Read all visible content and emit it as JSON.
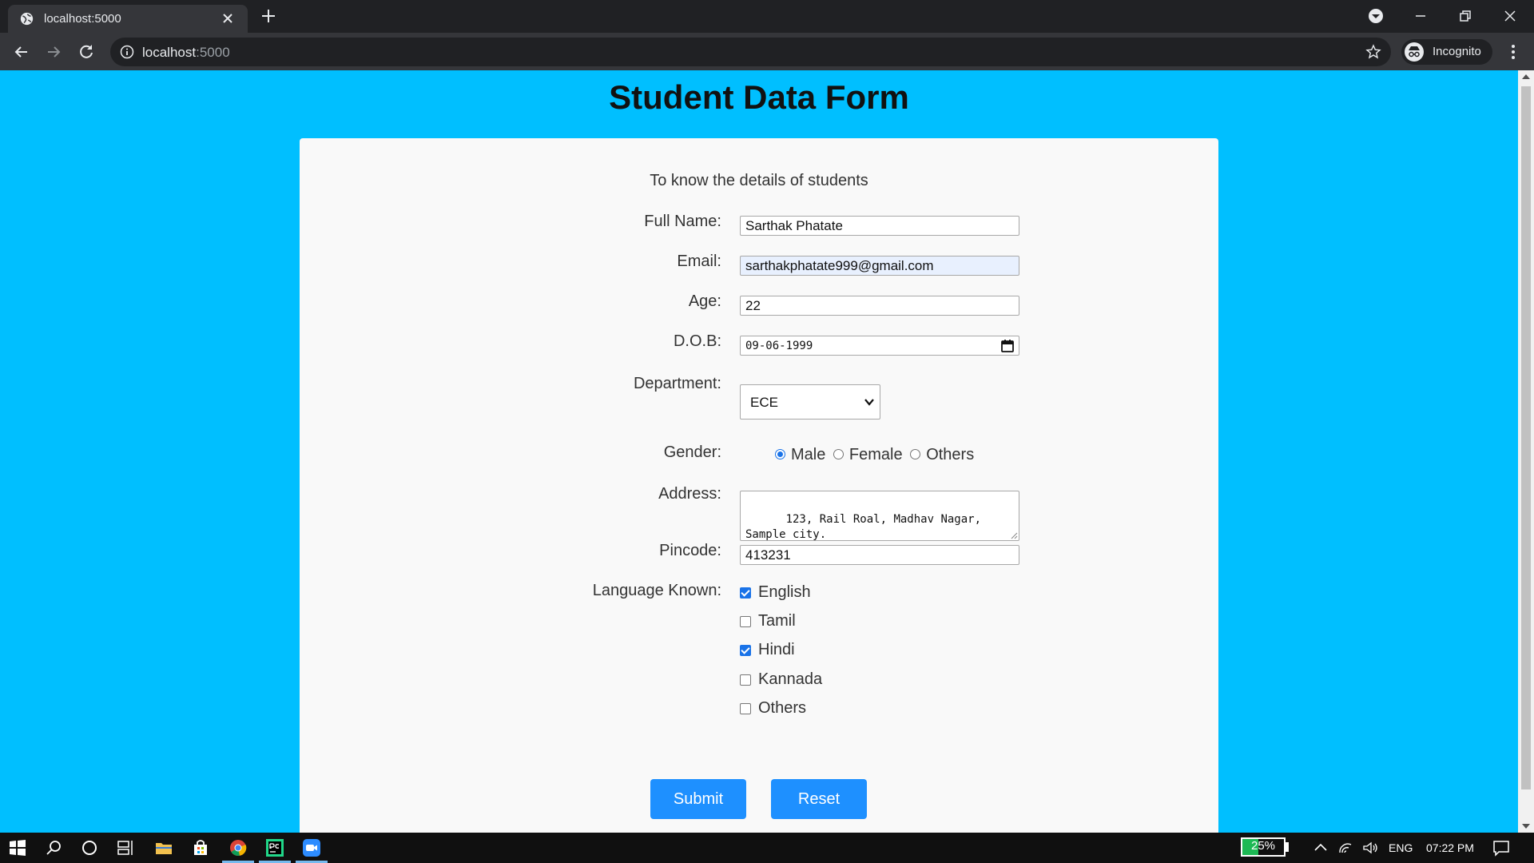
{
  "browser": {
    "tab_title": "localhost:5000",
    "url_host": "localhost",
    "url_port": ":5000",
    "profile_label": "Incognito"
  },
  "page": {
    "title": "Student Data Form",
    "subtitle": "To know the details of students"
  },
  "form": {
    "full_name": {
      "label": "Full Name:",
      "value": "Sarthak Phatate"
    },
    "email": {
      "label": "Email:",
      "value": "sarthakphatate999@gmail.com"
    },
    "age": {
      "label": "Age:",
      "value": "22"
    },
    "dob": {
      "label": "D.O.B:",
      "value": "09-06-1999"
    },
    "department": {
      "label": "Department:",
      "selected": "ECE"
    },
    "gender": {
      "label": "Gender:",
      "options": [
        "Male",
        "Female",
        "Others"
      ],
      "selected": "Male"
    },
    "address": {
      "label": "Address:",
      "value": "123, Rail Roal, Madhav Nagar, Sample city."
    },
    "pincode": {
      "label": "Pincode:",
      "value": "413231"
    },
    "languages": {
      "label": "Language Known:",
      "options": [
        {
          "label": "English",
          "checked": true
        },
        {
          "label": "Tamil",
          "checked": false
        },
        {
          "label": "Hindi",
          "checked": true
        },
        {
          "label": "Kannada",
          "checked": false
        },
        {
          "label": "Others",
          "checked": false
        }
      ]
    },
    "submit_label": "Submit",
    "reset_label": "Reset"
  },
  "taskbar": {
    "battery": "25%",
    "language": "ENG",
    "time": "07:22 PM"
  },
  "colors": {
    "page_bg": "#00bfff",
    "accent": "#1e90ff",
    "checkbox": "#1a73e8"
  }
}
